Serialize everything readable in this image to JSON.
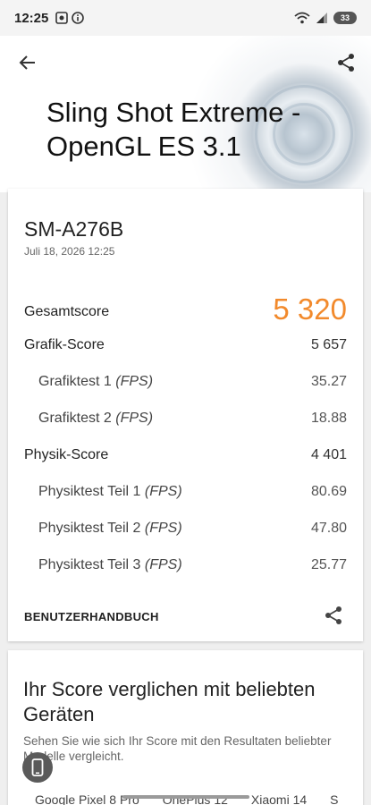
{
  "status_bar": {
    "time": "12:25",
    "battery": "33"
  },
  "hero": {
    "title": "Sling Shot Extreme - OpenGL ES 3.1"
  },
  "device": {
    "name": "SM-A276B",
    "date": "Juli 18, 2026 12:25"
  },
  "scores": {
    "overall": {
      "label": "Gesamtscore",
      "value": "5 320"
    },
    "graphics": {
      "label": "Grafik-Score",
      "value": "5 657"
    },
    "graphics_test_1": {
      "label": "Grafiktest 1 ",
      "unit": "(FPS)",
      "value": "35.27"
    },
    "graphics_test_2": {
      "label": "Grafiktest 2 ",
      "unit": "(FPS)",
      "value": "18.88"
    },
    "physics": {
      "label": "Physik-Score",
      "value": "4 401"
    },
    "physics_test_1": {
      "label": "Physiktest Teil 1 ",
      "unit": "(FPS)",
      "value": "80.69"
    },
    "physics_test_2": {
      "label": "Physiktest Teil 2 ",
      "unit": "(FPS)",
      "value": "47.80"
    },
    "physics_test_3": {
      "label": "Physiktest Teil 3 ",
      "unit": "(FPS)",
      "value": "25.77"
    }
  },
  "manual_label": "BENUTZERHANDBUCH",
  "compare": {
    "title": "Ihr Score verglichen mit beliebten Geräten",
    "subtitle": "Sehen Sie wie sich Ihr Score mit den Resultaten beliebter Modelle vergleicht.",
    "tabs": [
      "Google Pixel 8 Pro",
      "OnePlus 12",
      "Xiaomi 14",
      "S"
    ]
  },
  "colors": {
    "accent": "#f28a2c",
    "card": "#ffffff",
    "background": "#efefef"
  },
  "icons": [
    "back-arrow-icon",
    "share-icon",
    "screen-record-icon",
    "info-icon",
    "wifi-icon",
    "signal-icon",
    "phone-icon"
  ]
}
